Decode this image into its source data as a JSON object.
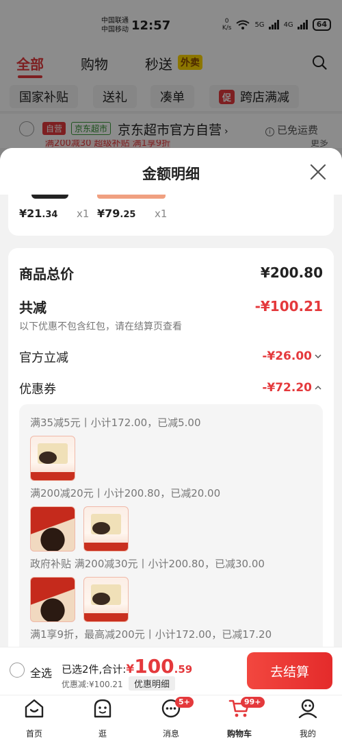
{
  "status_bar": {
    "carrier_1": "中国联通",
    "carrier_2": "中国移动",
    "time": "12:57",
    "net_speed_value": "0",
    "net_speed_unit": "K/s",
    "signal_1": "5G",
    "signal_2": "4G",
    "battery": "64"
  },
  "top_tabs": [
    {
      "label": "全部"
    },
    {
      "label": "购物"
    },
    {
      "label": "秒送"
    }
  ],
  "waimai_tag": "外卖",
  "chips": [
    {
      "label": "国家补贴"
    },
    {
      "label": "送礼"
    },
    {
      "label": "凑单"
    },
    {
      "label": "跨店满减",
      "icon_text": "促"
    }
  ],
  "store": {
    "tag_self": "自营",
    "tag_supermarket": "京东超市",
    "name": "京东超市官方自营",
    "arrow": "›",
    "shipping": "已免运费",
    "promo_partial": "满200减30 超级补贴 满1享9折",
    "more": "更多"
  },
  "sheet": {
    "title": "金额明细",
    "items": [
      {
        "price_symbol": "¥",
        "price_int": "21",
        "price_dec": ".34",
        "qty": "x1"
      },
      {
        "price_symbol": "¥",
        "price_int": "79",
        "price_dec": ".25",
        "qty": "x1"
      }
    ],
    "total_label": "商品总价",
    "total_value": "¥200.80",
    "reduce_label": "共减",
    "reduce_value": "-¥100.21",
    "reduce_note": "以下优惠不包含红包，请在结算页查看",
    "official_label": "官方立减",
    "official_value": "-¥26.00",
    "coupon_label": "优惠券",
    "coupon_value": "-¥72.20",
    "coupon_lines": [
      {
        "text": "满35减5元丨小计172.00，已减5.00"
      },
      {
        "text": "满200减20元丨小计200.80，已减20.00"
      },
      {
        "text": "政府补贴 满200减30元丨小计200.80，已减30.00"
      },
      {
        "text": "满1享9折，最高减200元丨小计172.00，已减17.20"
      }
    ]
  },
  "bottom_bar": {
    "select_all": "全选",
    "selected": "已选2件,合计:",
    "currency": "¥",
    "total_int": "100",
    "total_dec": ".59",
    "discount": "优惠减:¥100.21",
    "detail": "优惠明细",
    "checkout": "去结算"
  },
  "tabbar": [
    {
      "label": "首页",
      "icon": "home-icon"
    },
    {
      "label": "逛",
      "icon": "browse-icon"
    },
    {
      "label": "消息",
      "icon": "message-icon",
      "badge": "5+"
    },
    {
      "label": "购物车",
      "icon": "cart-icon",
      "badge": "99+",
      "active": true
    },
    {
      "label": "我的",
      "icon": "profile-icon"
    }
  ],
  "colors": {
    "accent": "#e4393c",
    "overlay": "rgba(0,0,0,0.45)",
    "yellow_tag": "#ffd800"
  }
}
